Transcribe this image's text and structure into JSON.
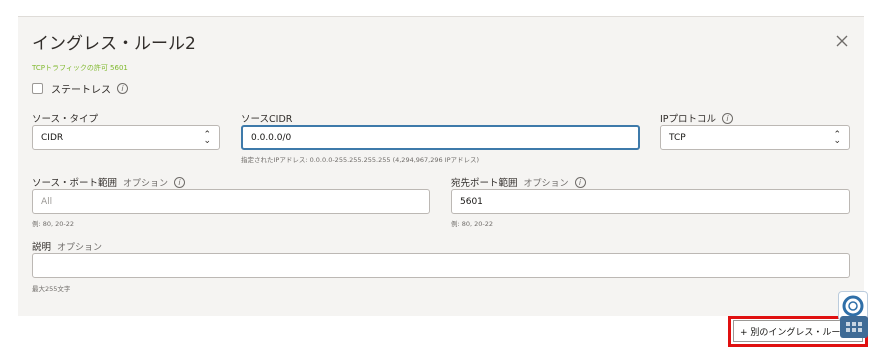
{
  "rule": {
    "title": "イングレス・ルール2",
    "note": "TCPトラフィックの許可 5601",
    "stateless_label": "ステートレス"
  },
  "fields": {
    "source_type": {
      "label": "ソース・タイプ",
      "value": "CIDR"
    },
    "source_cidr": {
      "label": "ソースCIDR",
      "value": "0.0.0.0/0",
      "hint": "指定されたIPアドレス: 0.0.0.0-255.255.255.255 (4,294,967,296 IPアドレス)"
    },
    "ip_protocol": {
      "label": "IPプロトコル",
      "value": "TCP"
    },
    "source_port": {
      "label": "ソース・ポート範囲",
      "optional": "オプション",
      "placeholder": "All",
      "hint": "例: 80, 20-22"
    },
    "dest_port": {
      "label": "宛先ポート範囲",
      "optional": "オプション",
      "value": "5601",
      "hint": "例: 80, 20-22"
    },
    "description": {
      "label": "説明",
      "optional": "オプション",
      "value": "",
      "hint": "最大255文字"
    }
  },
  "actions": {
    "add_rule": "+ 別のイングレス・ルール"
  },
  "icons": {
    "close": "close-icon",
    "info": "info-icon",
    "help": "lifebuoy-icon",
    "apps": "grid-icon"
  },
  "colors": {
    "note_green": "#7fb82d",
    "focus_blue": "#3e7aaa",
    "highlight_red": "#e01010"
  }
}
